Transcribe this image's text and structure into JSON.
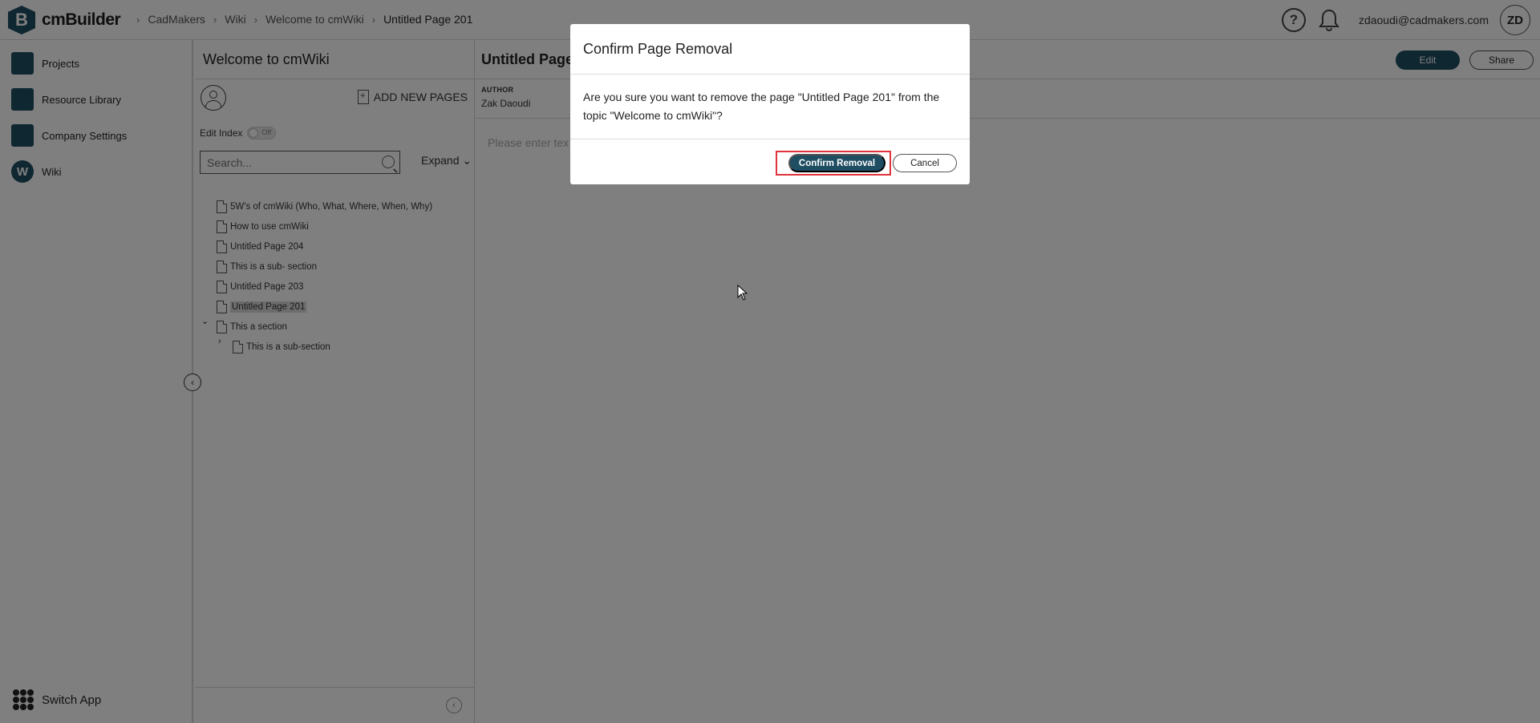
{
  "app": {
    "name": "cmBuilder",
    "logo_letter": "B"
  },
  "breadcrumb": [
    "CadMakers",
    "Wiki",
    "Welcome to cmWiki",
    "Untitled Page 201"
  ],
  "header": {
    "help_icon": "question-circle-icon",
    "bell_icon": "bell-icon",
    "user_email": "zdaoudi@cadmakers.com",
    "avatar_initials": "ZD"
  },
  "sidebar": {
    "items": [
      {
        "label": "Projects",
        "icon": "projects-icon"
      },
      {
        "label": "Resource Library",
        "icon": "resource-library-icon"
      },
      {
        "label": "Company Settings",
        "icon": "company-settings-icon"
      },
      {
        "label": "Wiki",
        "icon": "wiki-icon",
        "icon_letter": "W"
      }
    ],
    "switch_app": "Switch App"
  },
  "index": {
    "title": "Welcome to cmWiki",
    "add_pages": "ADD NEW PAGES",
    "edit_index_label": "Edit Index",
    "toggle_state": "Off",
    "search_placeholder": "Search...",
    "expand": "Expand",
    "pages": [
      "5W's of cmWiki (Who, What, Where, When, Why)",
      "How to use cmWiki",
      "Untitled Page 204",
      "This is a sub- section",
      "Untitled Page 203",
      "Untitled Page 201",
      "This a section",
      "This is a sub-section"
    ],
    "selected": "Untitled Page 201"
  },
  "main": {
    "title": "Untitled Page",
    "author_label": "AUTHOR",
    "author_name": "Zak Daoudi",
    "editor_placeholder": "Please enter tex",
    "edit_button": "Edit",
    "share_button": "Share"
  },
  "modal": {
    "title": "Confirm Page Removal",
    "body": "Are you sure you want to remove the page \"Untitled Page 201\" from the topic \"Welcome to cmWiki\"?",
    "confirm": "Confirm Removal",
    "cancel": "Cancel"
  },
  "colors": {
    "brand": "#1f4e63",
    "highlight": "#e0333b"
  }
}
